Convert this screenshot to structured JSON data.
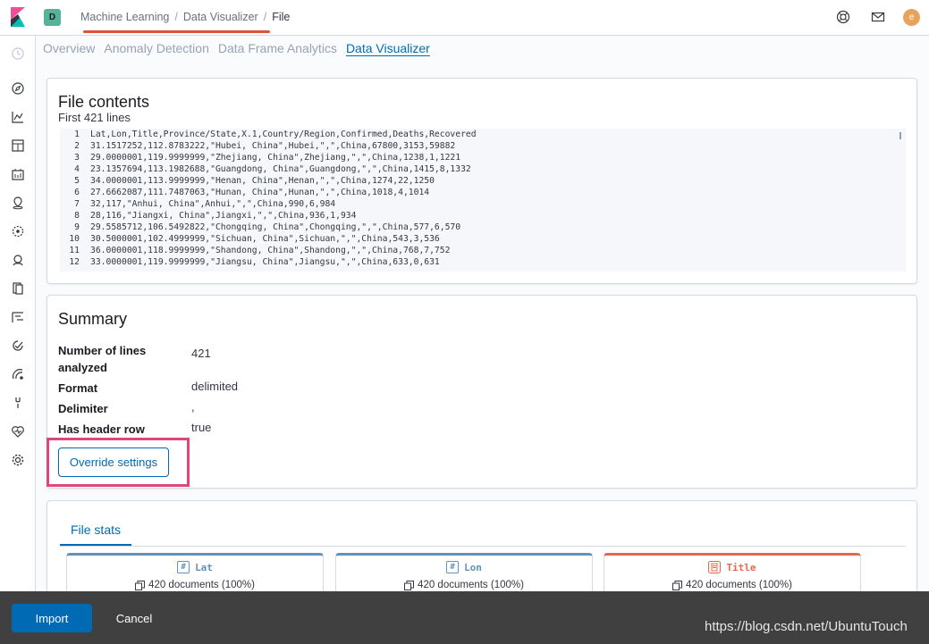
{
  "header": {
    "space_initial": "D",
    "breadcrumbs": [
      "Machine Learning",
      "Data Visualizer",
      "File"
    ],
    "user_initial": "e",
    "accent": "#e0513b"
  },
  "tabs": [
    {
      "label": "Overview",
      "active": false
    },
    {
      "label": "Anomaly Detection",
      "active": false
    },
    {
      "label": "Data Frame Analytics",
      "active": false
    },
    {
      "label": "Data Visualizer",
      "active": true
    }
  ],
  "sidenav": {
    "icons": [
      "clock-icon",
      "discover-icon",
      "visualize-icon",
      "dashboard-icon",
      "canvas-icon",
      "maps-icon",
      "ml-icon",
      "metrics-icon",
      "logs-icon",
      "apm-icon",
      "uptime-icon",
      "siem-icon",
      "dev-tools-icon",
      "monitoring-icon",
      "management-icon"
    ]
  },
  "file_contents": {
    "title": "File contents",
    "subtitle": "First 421 lines",
    "lines": [
      {
        "n": "1",
        "text": "Lat,Lon,Title,Province/State,X.1,Country/Region,Confirmed,Deaths,Recovered"
      },
      {
        "n": "2",
        "text": "31.1517252,112.8783222,\"Hubei, China\",Hubei,\",\",China,67800,3153,59882"
      },
      {
        "n": "3",
        "text": "29.0000001,119.9999999,\"Zhejiang, China\",Zhejiang,\",\",China,1238,1,1221"
      },
      {
        "n": "4",
        "text": "23.1357694,113.1982688,\"Guangdong, China\",Guangdong,\",\",China,1415,8,1332"
      },
      {
        "n": "5",
        "text": "34.0000001,113.9999999,\"Henan, China\",Henan,\",\",China,1274,22,1250"
      },
      {
        "n": "6",
        "text": "27.6662087,111.7487063,\"Hunan, China\",Hunan,\",\",China,1018,4,1014"
      },
      {
        "n": "7",
        "text": "32,117,\"Anhui, China\",Anhui,\",\",China,990,6,984"
      },
      {
        "n": "8",
        "text": "28,116,\"Jiangxi, China\",Jiangxi,\",\",China,936,1,934"
      },
      {
        "n": "9",
        "text": "29.5585712,106.5492822,\"Chongqing, China\",Chongqing,\",\",China,577,6,570"
      },
      {
        "n": "10",
        "text": "30.5000001,102.4999999,\"Sichuan, China\",Sichuan,\",\",China,543,3,536"
      },
      {
        "n": "11",
        "text": "36.0000001,118.9999999,\"Shandong, China\",Shandong,\",\",China,768,7,752"
      },
      {
        "n": "12",
        "text": "33.0000001,119.9999999,\"Jiangsu, China\",Jiangsu,\",\",China,633,0,631"
      }
    ]
  },
  "summary": {
    "title": "Summary",
    "rows": [
      {
        "label": "Number of lines analyzed",
        "value": "421"
      },
      {
        "label": "Format",
        "value": "delimited"
      },
      {
        "label": "Delimiter",
        "value": ","
      },
      {
        "label": "Has header row",
        "value": "true"
      }
    ],
    "override_label": "Override settings",
    "highlight_color": "#e0457b"
  },
  "file_stats": {
    "tab_label": "File stats",
    "cards": [
      {
        "name": "Lat",
        "type_icon": "#",
        "docs": "420 documents (100%)",
        "kind": "number"
      },
      {
        "name": "Lon",
        "type_icon": "#",
        "docs": "420 documents (100%)",
        "kind": "number"
      },
      {
        "name": "Title",
        "type_icon": "text-icon",
        "docs": "420 documents (100%)",
        "kind": "text"
      }
    ]
  },
  "footer": {
    "import_label": "Import",
    "cancel_label": "Cancel",
    "watermark": "https://blog.csdn.net/UbuntuTouch"
  }
}
